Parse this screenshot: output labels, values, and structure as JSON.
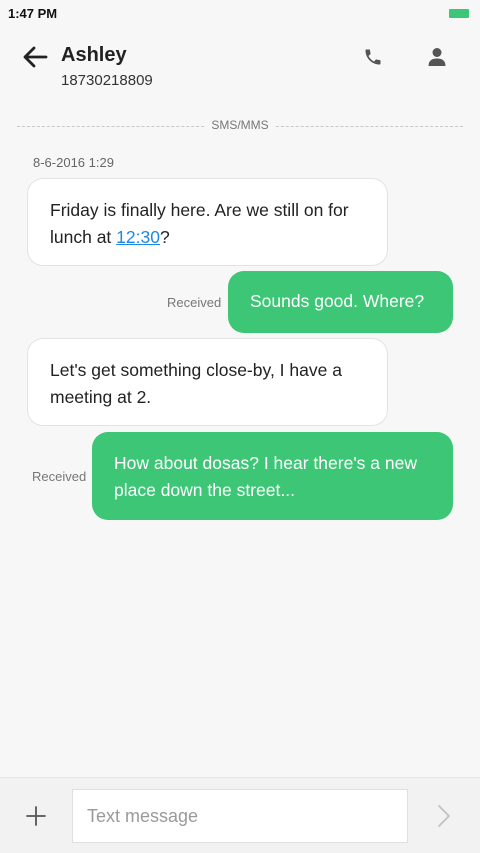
{
  "status_bar": {
    "time": "1:47 PM",
    "battery_color": "#3cc676"
  },
  "header": {
    "back_icon": "arrow-left-icon",
    "contact_name": "Ashley",
    "contact_number": "18730218809",
    "call_icon": "phone-icon",
    "profile_icon": "person-icon"
  },
  "thread": {
    "channel_label": "SMS/MMS",
    "timestamp": "8-6-2016 1:29",
    "messages": [
      {
        "direction": "incoming",
        "text_before": "Friday is finally here. Are we still on for lunch at ",
        "link": "12:30",
        "text_after": "?"
      },
      {
        "direction": "outgoing",
        "status": "Received",
        "text": "Sounds good. Where?"
      },
      {
        "direction": "incoming",
        "text": "Let's get something close-by, I have a meeting at 2."
      },
      {
        "direction": "outgoing",
        "status": "Received",
        "text": "How about dosas? I hear there's a new place down the street..."
      }
    ]
  },
  "composer": {
    "add_icon": "plus-icon",
    "placeholder": "Text message",
    "value": "",
    "send_icon": "chevron-right-icon"
  },
  "colors": {
    "outgoing_bubble": "#3cc676",
    "link": "#1e88e5"
  }
}
